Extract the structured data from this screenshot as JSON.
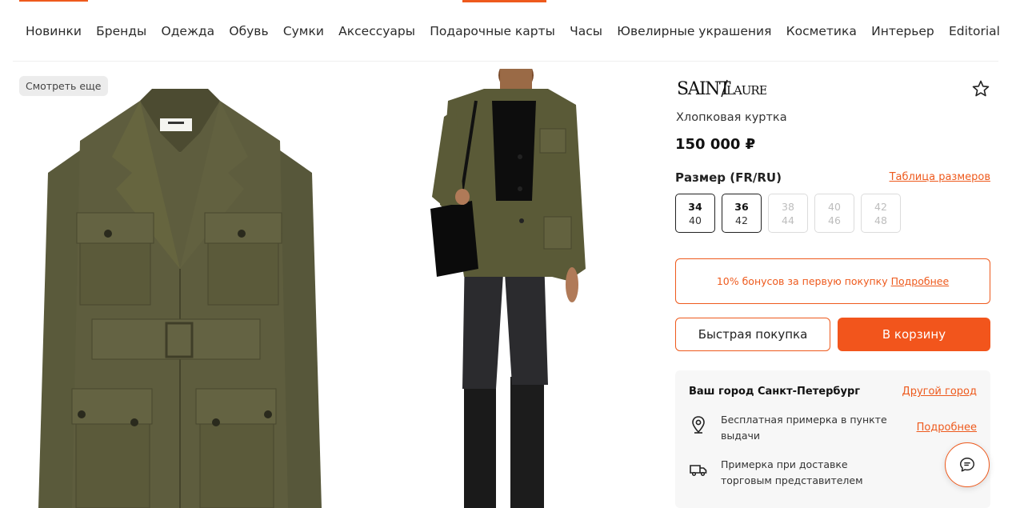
{
  "nav": {
    "items": [
      "Новинки",
      "Бренды",
      "Одежда",
      "Обувь",
      "Сумки",
      "Аксессуары",
      "Подарочные карты",
      "Часы",
      "Ювелирные украшения",
      "Косметика",
      "Интерьер",
      "Editorial"
    ]
  },
  "gallery": {
    "see_more": "Смотреть еще"
  },
  "product": {
    "brand": "SAINT LAURENT",
    "name": "Хлопковая куртка",
    "price": "150 000 ₽",
    "size_title": "Размер (FR/RU)",
    "size_table_link": "Таблица размеров",
    "sizes": [
      {
        "fr": "34",
        "ru": "40",
        "available": true
      },
      {
        "fr": "36",
        "ru": "42",
        "available": true
      },
      {
        "fr": "38",
        "ru": "44",
        "available": false
      },
      {
        "fr": "40",
        "ru": "46",
        "available": false
      },
      {
        "fr": "42",
        "ru": "48",
        "available": false
      }
    ]
  },
  "bonus": {
    "text": "10% бонусов за первую покупку",
    "link": "Подробнее"
  },
  "buttons": {
    "quick_buy": "Быстрая покупка",
    "add_to_cart": "В корзину"
  },
  "delivery": {
    "city": "Ваш город Санкт-Петербург",
    "change_city": "Другой город",
    "pickup_text": "Бесплатная примерка в пункте выдачи",
    "pickup_link": "Подробнее",
    "courier_text": "Примерка при доставке торговым представителем"
  },
  "colors": {
    "accent": "#ee5a1d",
    "jacket": "#5b5a3c"
  }
}
